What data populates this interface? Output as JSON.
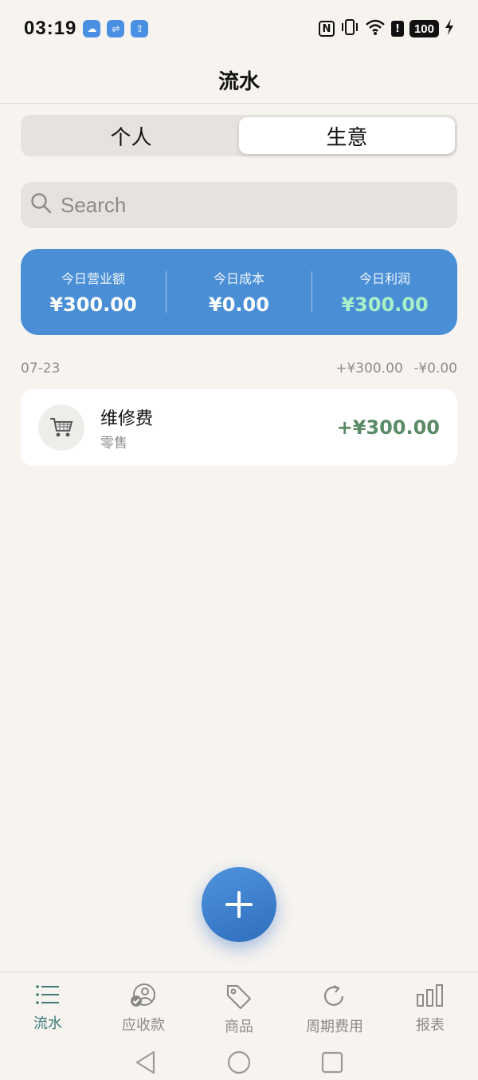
{
  "status_bar": {
    "time": "03:19",
    "battery": "100",
    "icons": [
      "weather-icon",
      "usb-icon",
      "upload-icon",
      "nfc-icon",
      "vibrate-icon",
      "wifi-icon",
      "alert-icon",
      "battery-icon",
      "charging-icon"
    ]
  },
  "header": {
    "title": "流水"
  },
  "segment": {
    "personal": "个人",
    "business": "生意",
    "selected": "生意"
  },
  "search": {
    "placeholder": "Search"
  },
  "summary": {
    "revenue_label": "今日营业额",
    "revenue_value": "¥300.00",
    "cost_label": "今日成本",
    "cost_value": "¥0.00",
    "profit_label": "今日利润",
    "profit_value": "¥300.00"
  },
  "groups": [
    {
      "date": "07-23",
      "income": "+¥300.00",
      "expense": "-¥0.00",
      "transactions": [
        {
          "title": "维修费",
          "subtitle": "零售",
          "amount": "+¥300.00",
          "icon": "cart-icon"
        }
      ]
    }
  ],
  "bottom_nav": [
    {
      "label": "流水",
      "icon": "list-icon",
      "active": true
    },
    {
      "label": "应收款",
      "icon": "receivable-icon",
      "active": false
    },
    {
      "label": "商品",
      "icon": "tag-icon",
      "active": false
    },
    {
      "label": "周期费用",
      "icon": "refresh-icon",
      "active": false
    },
    {
      "label": "报表",
      "icon": "bar-chart-icon",
      "active": false
    }
  ],
  "colors": {
    "accent": "#4a8fd6",
    "profit": "#a8f0c8",
    "income": "#5b8a66",
    "nav_active": "#3d7a78",
    "background": "#f7f4f0"
  }
}
